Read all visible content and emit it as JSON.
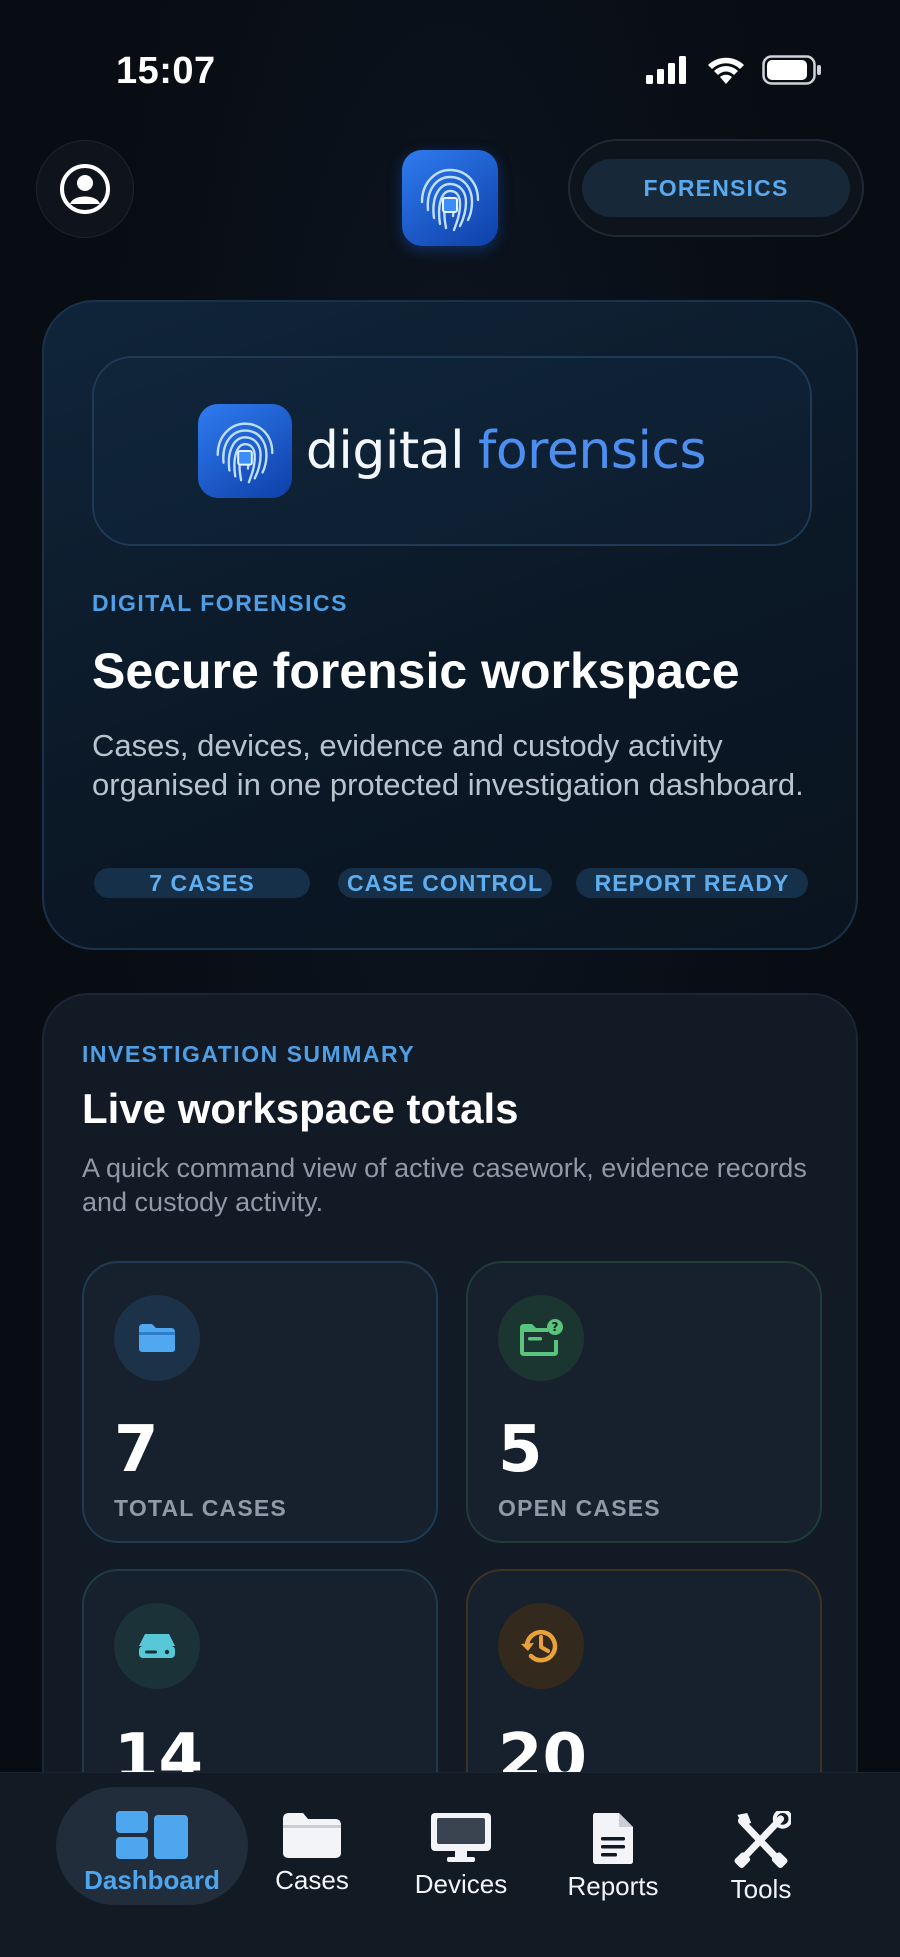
{
  "status_bar": {
    "time": "15:07"
  },
  "header": {
    "mode_label": "FORENSICS"
  },
  "hero": {
    "logo_word_1": "digital",
    "logo_word_2": "forensics",
    "eyebrow": "DIGITAL FORENSICS",
    "title": "Secure forensic workspace",
    "body": "Cases, devices, evidence and custody activity organised in one protected investigation dashboard.",
    "chips": [
      "7 CASES",
      "CASE CONTROL",
      "REPORT READY"
    ]
  },
  "summary": {
    "eyebrow": "INVESTIGATION SUMMARY",
    "title": "Live workspace totals",
    "description": "A quick command view of active casework, evidence records and custody activity.",
    "stats": [
      {
        "value": "7",
        "label": "TOTAL CASES",
        "icon": "folder-icon",
        "accent": "#4fa8f0"
      },
      {
        "value": "5",
        "label": "OPEN CASES",
        "icon": "folder-question-icon",
        "accent": "#58c47e"
      },
      {
        "value": "14",
        "label": "",
        "icon": "drive-icon",
        "accent": "#57c9d6"
      },
      {
        "value": "20",
        "label": "",
        "icon": "history-icon",
        "accent": "#e9a23b"
      }
    ]
  },
  "tabs": [
    {
      "label": "Dashboard",
      "icon": "dashboard-icon",
      "active": true
    },
    {
      "label": "Cases",
      "icon": "folder-icon"
    },
    {
      "label": "Devices",
      "icon": "monitor-icon"
    },
    {
      "label": "Reports",
      "icon": "document-icon"
    },
    {
      "label": "Tools",
      "icon": "tools-icon"
    }
  ],
  "colors": {
    "accent": "#4da6ee",
    "background": "#080c13",
    "card": "#121a25"
  }
}
